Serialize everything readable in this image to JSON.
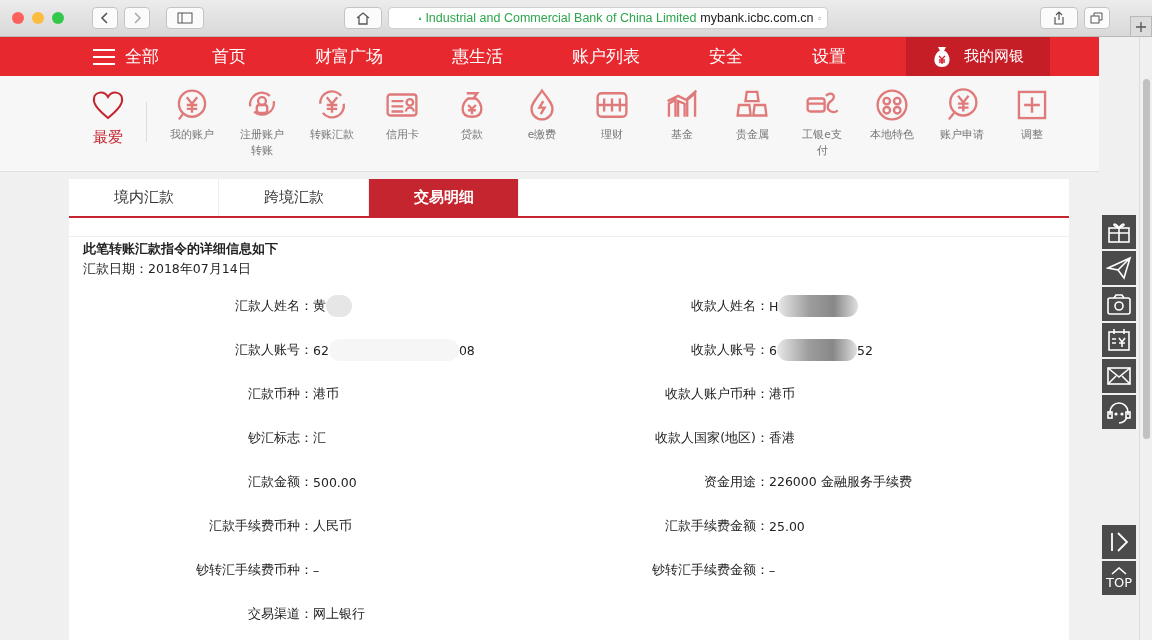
{
  "browser": {
    "site_name": "Industrial and Commercial Bank of China Limited",
    "url": "mybank.icbc.com.cn"
  },
  "nav": {
    "menu_label": "全部",
    "items": [
      {
        "label": "首页",
        "selected": false
      },
      {
        "label": "财富广场",
        "selected": false
      },
      {
        "label": "惠生活",
        "selected": false
      },
      {
        "label": "账户列表",
        "selected": false
      },
      {
        "label": "安全",
        "selected": false
      },
      {
        "label": "设置",
        "selected": false
      }
    ],
    "account": "我的网银"
  },
  "favorites": {
    "label": "最爱",
    "shortcuts": [
      "我的账户",
      "注册账户转账",
      "转账汇款",
      "信用卡",
      "贷款",
      "e缴费",
      "理财",
      "基金",
      "贵金属",
      "工银e支付",
      "本地特色",
      "账户申请",
      "调整"
    ]
  },
  "tabs": [
    {
      "label": "境内汇款",
      "selected": false
    },
    {
      "label": "跨境汇款",
      "selected": false
    },
    {
      "label": "交易明细",
      "selected": true
    }
  ],
  "detail": {
    "heading": "此笔转账汇款指令的详细信息如下",
    "date_label": "汇款日期：",
    "date": "2018年07月14日",
    "rows": [
      {
        "left": {
          "label": "汇款人姓名：",
          "before": "黄",
          "redacted": true
        },
        "right": {
          "label": "收款人姓名：",
          "before": "H",
          "redacted": true
        }
      },
      {
        "left": {
          "label": "汇款人账号：",
          "before": "62",
          "redacted": true,
          "after": "08"
        },
        "right": {
          "label": "收款人账号：",
          "before": "6",
          "redacted": true,
          "after": "52"
        }
      },
      {
        "left": {
          "label": "汇款币种：",
          "before": "港币"
        },
        "right": {
          "label": "收款人账户币种：",
          "before": "港币"
        }
      },
      {
        "left": {
          "label": "钞汇标志：",
          "before": "汇"
        },
        "right": {
          "label": "收款人国家(地区)：",
          "before": "香港"
        }
      },
      {
        "left": {
          "label": "汇款金额：",
          "before": "500.00"
        },
        "right": {
          "label": "资金用途：",
          "before": "226000 金融服务手续费"
        }
      },
      {
        "left": {
          "label": "汇款手续费币种：",
          "before": "人民币"
        },
        "right": {
          "label": "汇款手续费金额：",
          "before": "25.00"
        }
      },
      {
        "left": {
          "label": "钞转汇手续费币种：",
          "before": "–"
        },
        "right": {
          "label": "钞转汇手续费金额：",
          "before": "–"
        }
      },
      {
        "left": {
          "label": "交易渠道：",
          "before": "网上银行"
        }
      }
    ]
  },
  "side_tools": {
    "top_label": "TOP"
  }
}
